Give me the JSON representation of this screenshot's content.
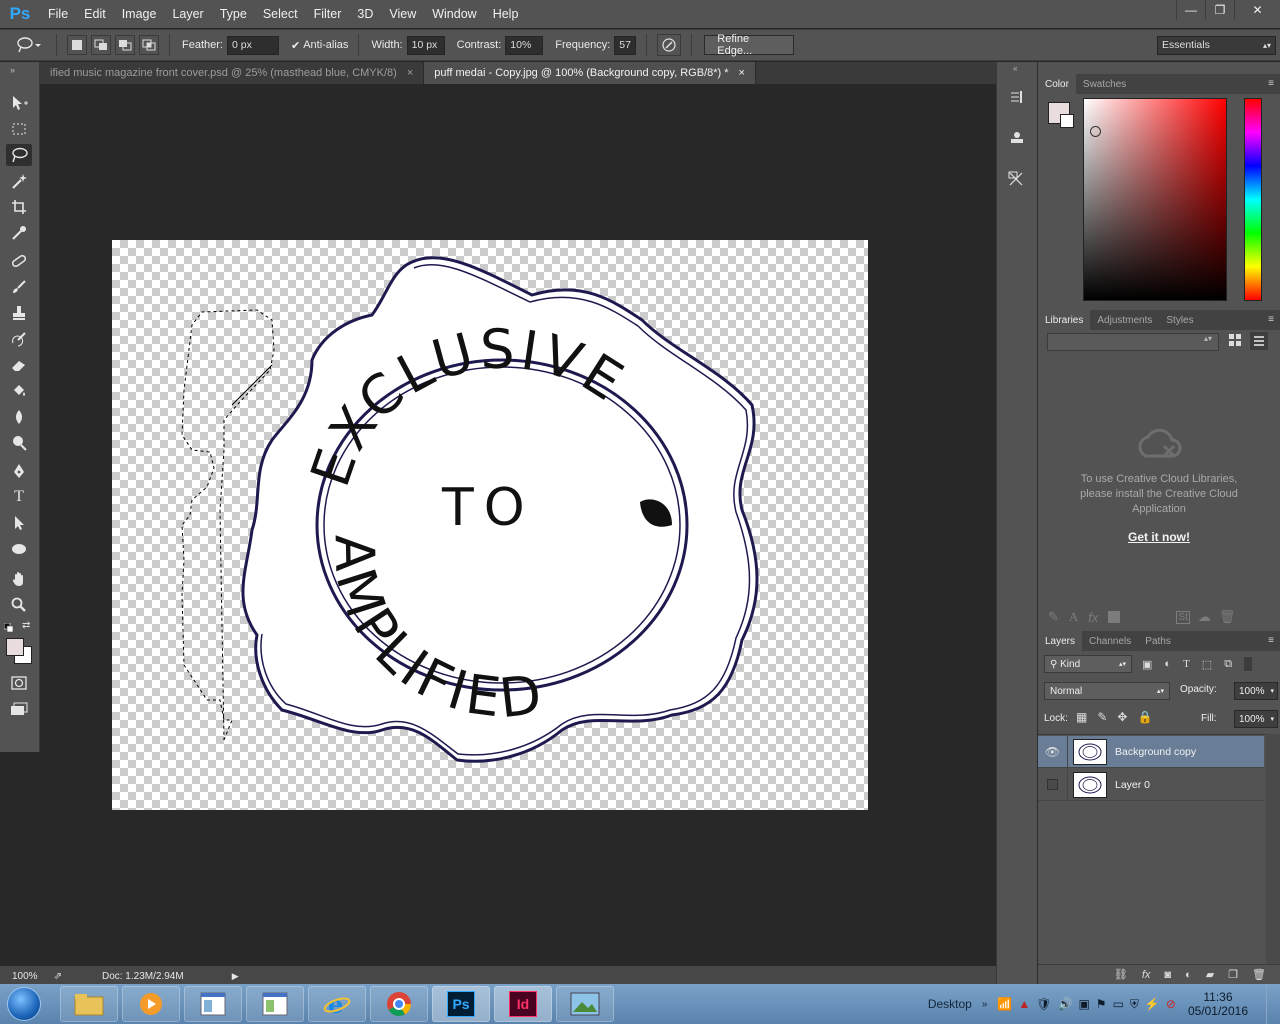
{
  "app": {
    "logo": "Ps"
  },
  "menu": [
    "File",
    "Edit",
    "Image",
    "Layer",
    "Type",
    "Select",
    "Filter",
    "3D",
    "View",
    "Window",
    "Help"
  ],
  "window_controls": {
    "minimize": "—",
    "restore": "❐",
    "close": "✕"
  },
  "options": {
    "feather_label": "Feather:",
    "feather_value": "0 px",
    "antialias_label": "Anti-alias",
    "antialias_checked": true,
    "width_label": "Width:",
    "width_value": "10 px",
    "contrast_label": "Contrast:",
    "contrast_value": "10%",
    "frequency_label": "Frequency:",
    "frequency_value": "57",
    "refine_label": "Refine Edge...",
    "workspace": "Essentials"
  },
  "tabs": [
    {
      "label": "ified music magazine front cover.psd @ 25% (masthead blue, CMYK/8)",
      "close": "×",
      "active": false
    },
    {
      "label": "puff medai - Copy.jpg @ 100% (Background copy, RGB/8*) *",
      "close": "×",
      "active": true
    }
  ],
  "stamp": {
    "top_text": "EXCLUSIVE",
    "middle_text": "TO",
    "bottom_text": "AMPLIFIED"
  },
  "status": {
    "zoom": "100%",
    "doc": "Doc: 1.23M/2.94M"
  },
  "color_panel": {
    "tabs": [
      "Color",
      "Swatches"
    ],
    "fg_color": "#e9dcdc",
    "bg_color": "#ffffff",
    "hue": "#ff0000"
  },
  "libraries_panel": {
    "tabs": [
      "Libraries",
      "Adjustments",
      "Styles"
    ],
    "message": "To use Creative Cloud Libraries, please install the Creative Cloud Application",
    "link": "Get it now!"
  },
  "layers_panel": {
    "tabs": [
      "Layers",
      "Channels",
      "Paths"
    ],
    "kind": "Kind",
    "blend": "Normal",
    "opacity_label": "Opacity:",
    "opacity": "100%",
    "lock_label": "Lock:",
    "fill_label": "Fill:",
    "fill": "100%",
    "layers": [
      {
        "name": "Background copy",
        "visible": true,
        "selected": true
      },
      {
        "name": "Layer 0",
        "visible": false,
        "selected": false
      }
    ]
  },
  "taskbar": {
    "apps": [
      "file-explorer",
      "media-player",
      "document-1",
      "document-2",
      "internet-explorer",
      "chrome",
      "photoshop",
      "indesign",
      "photo-viewer"
    ],
    "photoshop_label": "Ps",
    "indesign_label": "Id",
    "desktop_label": "Desktop",
    "time": "11:36",
    "date": "05/01/2016"
  }
}
